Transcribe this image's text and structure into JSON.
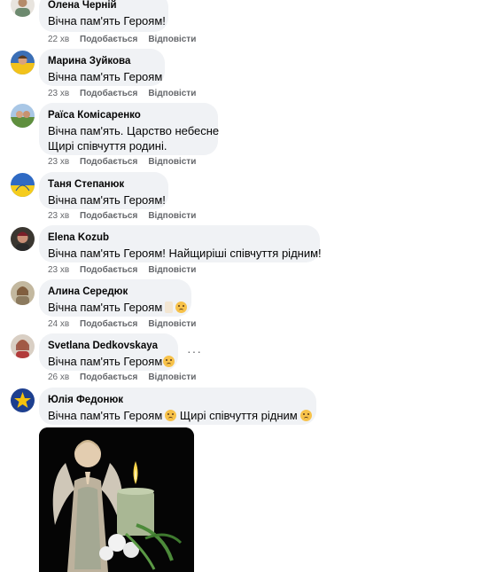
{
  "actions": {
    "like": "Подобається",
    "reply": "Відповісти"
  },
  "comments": [
    {
      "author": "Олена Черній",
      "lines": [
        "Вічна пам'ять Героям!"
      ],
      "time": "22 хв"
    },
    {
      "author": "Марина Зуйкова",
      "lines": [
        "Вічна пам'ять Героям"
      ],
      "time": "23 хв"
    },
    {
      "author": "Раїса Комісаренко",
      "lines": [
        "Вічна пам'ять. Царство небесне",
        "Щирі співчуття родині."
      ],
      "time": "23 хв"
    },
    {
      "author": "Таня Степанюк",
      "lines": [
        "Вічна пам'ять Героям!"
      ],
      "time": "23 хв"
    },
    {
      "author": "Elena Kozub",
      "lines": [
        "Вічна пам'ять Героям! Найщиріші співчуття рідним!"
      ],
      "time": "23 хв"
    },
    {
      "author": "Алина Середюк",
      "lines": [
        "Вічна пам'ять Героям"
      ],
      "time": "24 хв",
      "emojis": [
        "folded-hands-icon",
        "sad-face-icon"
      ]
    },
    {
      "author": "Svetlana Dedkovskaya",
      "lines": [
        "Вічна пам'ять Героям"
      ],
      "time": "26 хв",
      "emojis": [
        "crying-face-icon"
      ]
    },
    {
      "author": "Юлія Федонюк",
      "lines": [
        "Вічна пам'ять Героям",
        "Щирі співчуття рідним"
      ],
      "time": "",
      "emojis": [
        "sad-face-icon",
        "sad-face-icon"
      ]
    }
  ],
  "more_options": "···",
  "colors": {
    "bubble": "#f0f2f5",
    "meta": "#65676b",
    "text": "#050505"
  }
}
